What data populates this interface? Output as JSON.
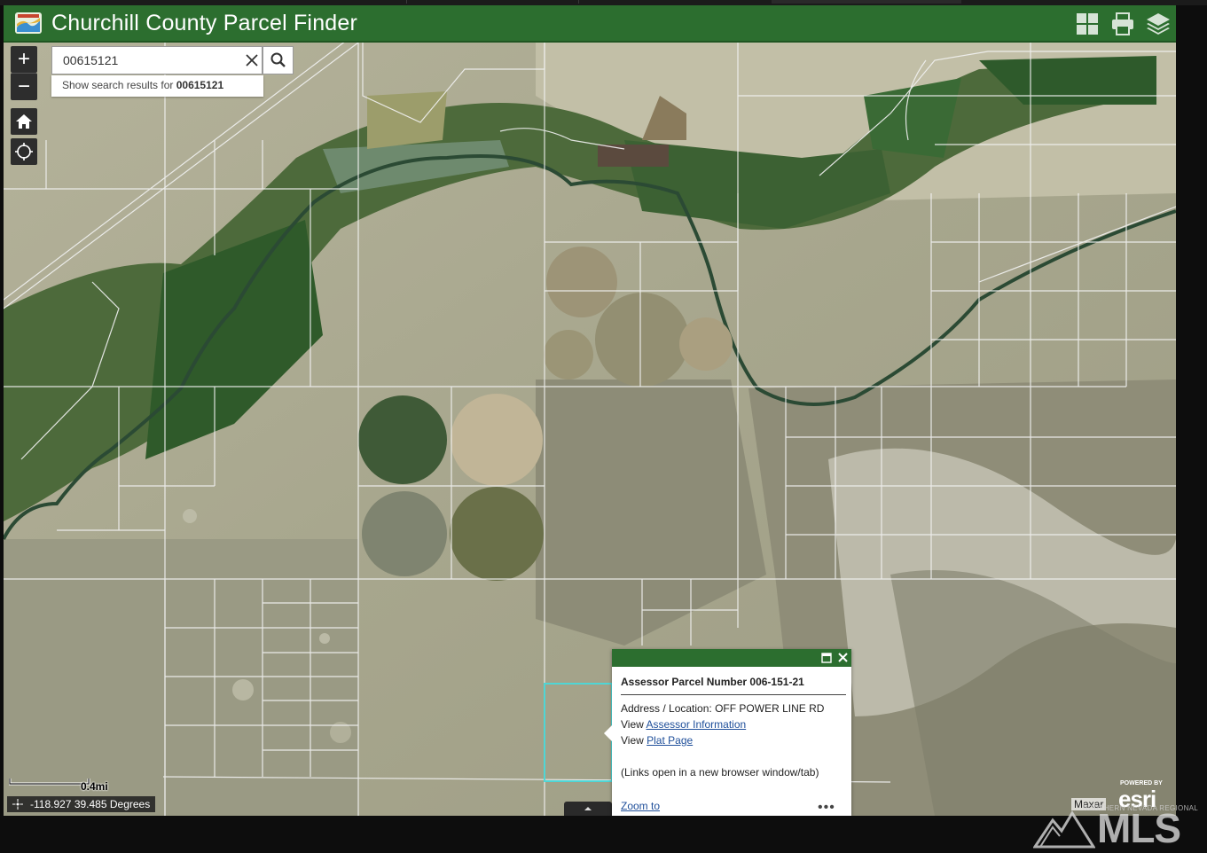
{
  "header": {
    "title": "Churchill County Parcel Finder",
    "logo_icon": "county-seal-icon",
    "buttons": [
      {
        "name": "basemap-gallery-icon"
      },
      {
        "name": "print-icon"
      },
      {
        "name": "layer-list-icon"
      }
    ],
    "bar_color": "#2c6e2f"
  },
  "map_controls": {
    "zoom_in": "+",
    "zoom_out": "−",
    "home_icon": "home-icon",
    "locate_icon": "locate-icon"
  },
  "search": {
    "value": "00615121",
    "suggestion_prefix": "Show search results for",
    "suggestion_term": "00615121"
  },
  "scale": {
    "label": "0.4mi"
  },
  "coordinates": {
    "text": "-118.927 39.485 Degrees"
  },
  "popup": {
    "title": "Assessor Parcel Number 006-151-21",
    "address_label": "Address / Location:",
    "address_value": "OFF POWER LINE RD",
    "view_label_1": "View",
    "assessor_link": "Assessor Information",
    "view_label_2": "View",
    "plat_link": "Plat Page",
    "note": "(Links open in a new browser window/tab)",
    "zoom_link": "Zoom to",
    "more_menu": "•••",
    "highlight_color": "#4fd6d6"
  },
  "attribution": {
    "powered_by": "POWERED BY",
    "esri": "esri",
    "provider": "Maxar"
  },
  "watermark": {
    "top_text": "NORTHERN NEVADA REGIONAL",
    "word": "MLS"
  }
}
